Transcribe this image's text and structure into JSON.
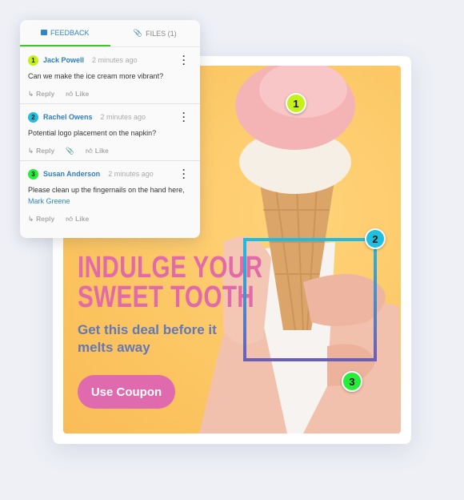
{
  "panel": {
    "tabs": [
      {
        "label": "FEEDBACK",
        "icon": "comment-icon",
        "active": true
      },
      {
        "label": "FILES (1)",
        "icon": "paperclip-icon",
        "active": false
      }
    ],
    "comments": [
      {
        "number": "1",
        "color": "#c6f01a",
        "author": "Jack Powell",
        "time": "2 minutes ago",
        "text": "Can we make the ice cream more vibrant?",
        "mention": "",
        "attachment": false
      },
      {
        "number": "2",
        "color": "#1fbfe0",
        "author": "Rachel Owens",
        "time": "2 minutes ago",
        "text": "Potential logo placement on the napkin?",
        "mention": "",
        "attachment": true
      },
      {
        "number": "3",
        "color": "#25ee3a",
        "author": "Susan Anderson",
        "time": "2 minutes ago",
        "text": "Please clean up the fingernails on the hand here, ",
        "mention": "Mark Greene",
        "attachment": false
      }
    ],
    "reply_label": "Reply",
    "like_label": "Like"
  },
  "ad": {
    "headline_1": "INDULGE YOUR",
    "headline_2": "SWEET TOOTH",
    "subtitle": "Get this deal before it melts away",
    "button": "Use Coupon",
    "colors": {
      "headline": "#e26aa8",
      "subtitle": "#6378b6",
      "button": "#e06aae",
      "background": "#fbc35e"
    }
  },
  "markers": [
    {
      "label": "1",
      "color": "#c6f01a"
    },
    {
      "label": "2",
      "color": "#1fbfe0"
    },
    {
      "label": "3",
      "color": "#25ee3a"
    }
  ]
}
